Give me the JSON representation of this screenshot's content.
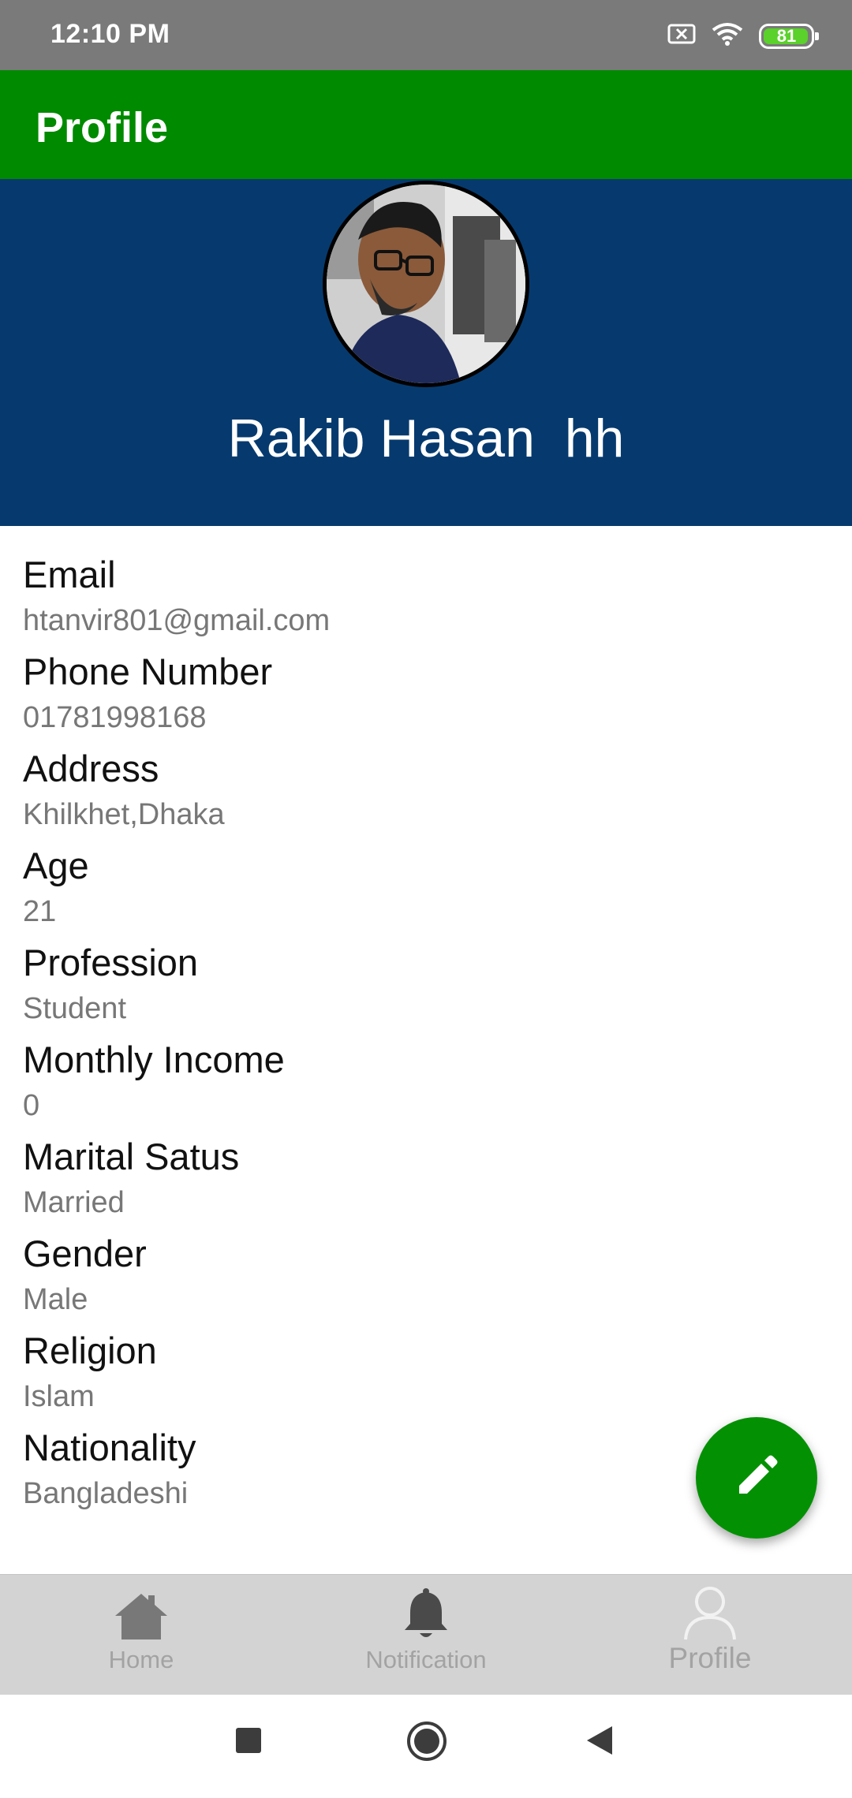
{
  "status_bar": {
    "time": "12:10 PM",
    "battery_level": "81",
    "icons": [
      "sim-blocked-icon",
      "wifi-icon",
      "battery-icon"
    ]
  },
  "app_bar": {
    "title": "Profile"
  },
  "profile": {
    "name": "Rakib Hasan  hh",
    "avatar_alt": "profile photo"
  },
  "details": [
    {
      "label": "Email",
      "value": "htanvir801@gmail.com"
    },
    {
      "label": "Phone Number",
      "value": "01781998168"
    },
    {
      "label": "Address",
      "value": "Khilkhet,Dhaka"
    },
    {
      "label": "Age",
      "value": "21"
    },
    {
      "label": "Profession",
      "value": "Student"
    },
    {
      "label": "Monthly Income",
      "value": "0"
    },
    {
      "label": "Marital Satus",
      "value": "Married"
    },
    {
      "label": "Gender",
      "value": "Male"
    },
    {
      "label": "Religion",
      "value": "Islam"
    },
    {
      "label": "Nationality",
      "value": "Bangladeshi"
    }
  ],
  "fab": {
    "icon": "edit-pencil-icon"
  },
  "bottom_nav": {
    "items": [
      {
        "label": "Home",
        "icon": "home-icon"
      },
      {
        "label": "Notification",
        "icon": "bell-icon"
      },
      {
        "label": "Profile",
        "icon": "person-icon",
        "active": true
      }
    ]
  },
  "colors": {
    "status_bar": "#7a7a7a",
    "app_bar": "#008a00",
    "header": "#063a6e",
    "fab": "#039103",
    "bottom_nav": "#d3d3d3",
    "nav_inactive": "#a3a3a3",
    "battery": "#5bd12b"
  }
}
